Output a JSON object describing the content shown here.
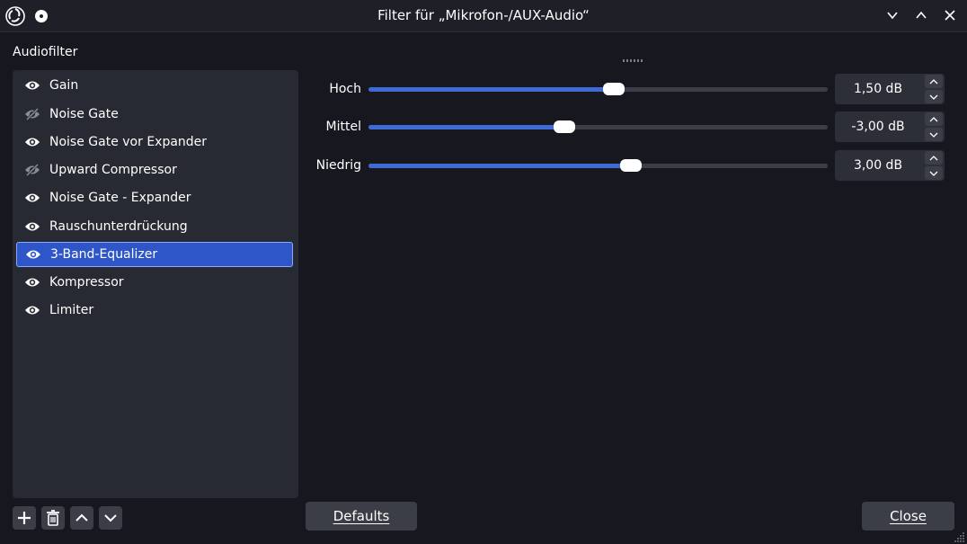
{
  "window": {
    "title": "Filter für „Mikrofon-/AUX-Audio“"
  },
  "sidebar": {
    "heading": "Audiofilter",
    "selected_index": 6,
    "items": [
      {
        "label": "Gain",
        "enabled": true
      },
      {
        "label": "Noise Gate",
        "enabled": false
      },
      {
        "label": "Noise Gate vor Expander",
        "enabled": true
      },
      {
        "label": "Upward Compressor",
        "enabled": false
      },
      {
        "label": "Noise Gate - Expander",
        "enabled": true
      },
      {
        "label": "Rauschunterdrückung",
        "enabled": true
      },
      {
        "label": "3-Band-Equalizer",
        "enabled": true
      },
      {
        "label": "Kompressor",
        "enabled": true
      },
      {
        "label": "Limiter",
        "enabled": true
      }
    ],
    "buttons": [
      "add-icon",
      "trash-icon",
      "arrow-up-icon",
      "arrow-down-icon"
    ]
  },
  "equalizer": {
    "bands": [
      {
        "label": "Hoch",
        "value": "1,50 dB",
        "slider_fraction": 0.535
      },
      {
        "label": "Mittel",
        "value": "-3,00 dB",
        "slider_fraction": 0.427
      },
      {
        "label": "Niedrig",
        "value": "3,00 dB",
        "slider_fraction": 0.572
      }
    ]
  },
  "footer": {
    "defaults_label": "Defaults",
    "close_label": "Close"
  },
  "colors": {
    "accent": "#3e6ad6",
    "selection": "#2f56c9",
    "background": "#17181f",
    "panel": "#282a33"
  }
}
